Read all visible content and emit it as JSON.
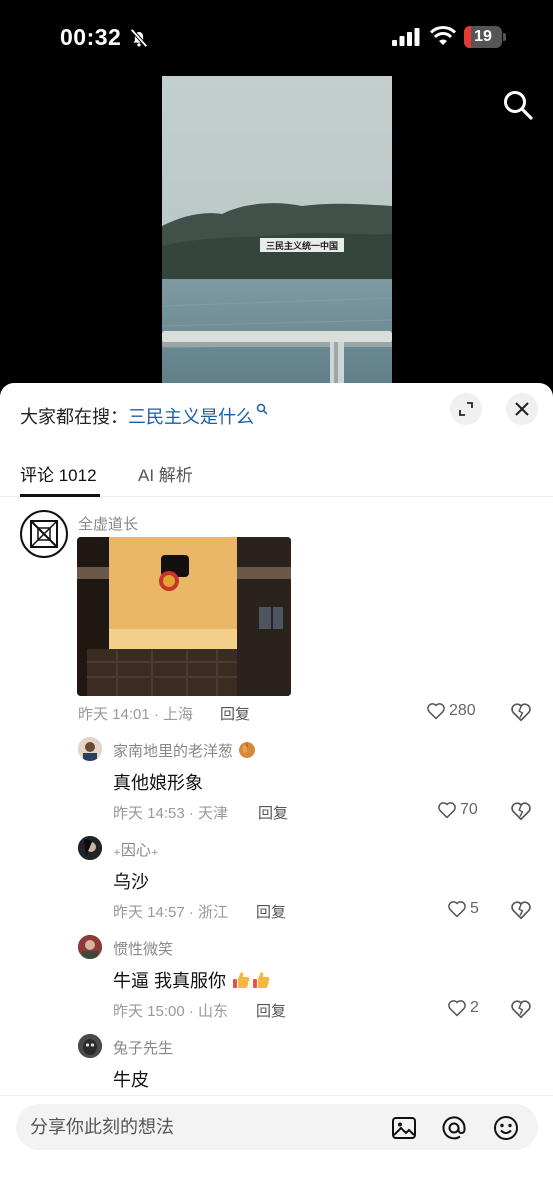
{
  "status_bar": {
    "time": "00:32",
    "battery": "19",
    "battery_level": 0.19
  },
  "video": {
    "banner_text": "三民主义统一中国"
  },
  "sheet": {
    "hot_search_label": "大家都在搜：",
    "hot_search_term": "三民主义是什么",
    "tabs": [
      {
        "label": "评论 1012",
        "active": true
      },
      {
        "label": "AI 解析",
        "active": false
      }
    ]
  },
  "comments": [
    {
      "username": "全虚道长",
      "time_location": "昨天 14:01 · 上海",
      "reply_label": "回复",
      "likes": "280",
      "has_image": true,
      "replies": [
        {
          "username": "家南地里的老洋葱",
          "text": "真他娘形象",
          "time_location": "昨天 14:53 · 天津",
          "reply_label": "回复",
          "likes": "70"
        },
        {
          "username": "₊因心₊",
          "text": "乌沙",
          "time_location": "昨天 14:57 · 浙江",
          "reply_label": "回复",
          "likes": "5"
        },
        {
          "username": "惯性微笑",
          "text": "牛逼 我真服你",
          "time_location": "昨天 15:00 · 山东",
          "reply_label": "回复",
          "likes": "2"
        },
        {
          "username": "兔子先生",
          "text": "牛皮"
        }
      ]
    }
  ],
  "input": {
    "placeholder": "分享你此刻的想法"
  },
  "icons": [
    "bell-off-icon",
    "signal-icon",
    "wifi-icon",
    "battery-icon",
    "search-icon",
    "expand-icon",
    "close-icon",
    "heart-icon",
    "dislike-icon",
    "image-icon",
    "at-icon",
    "emoji-icon"
  ],
  "colors": {
    "link": "#1b5fa8",
    "battery_low": "#e53935"
  }
}
